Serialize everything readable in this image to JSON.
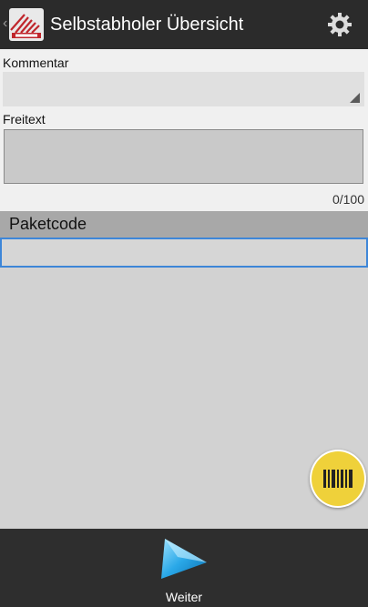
{
  "header": {
    "back_glyph": "‹",
    "title": "Selbstabholer Übersicht",
    "logo_icon": "company-logo",
    "settings_icon": "gear-icon"
  },
  "form": {
    "kommentar_label": "Kommentar",
    "kommentar_value": "",
    "freitext_label": "Freitext",
    "freitext_value": "",
    "freitext_counter": "0/100"
  },
  "paketcode": {
    "header": "Paketcode",
    "value": ""
  },
  "fab": {
    "icon": "barcode-icon"
  },
  "bottom": {
    "next_label": "Weiter",
    "next_icon": "play-icon"
  },
  "colors": {
    "actionbar": "#2b2b2b",
    "accent_blue": "#3d86d8",
    "fab_yellow": "#efd13a"
  }
}
